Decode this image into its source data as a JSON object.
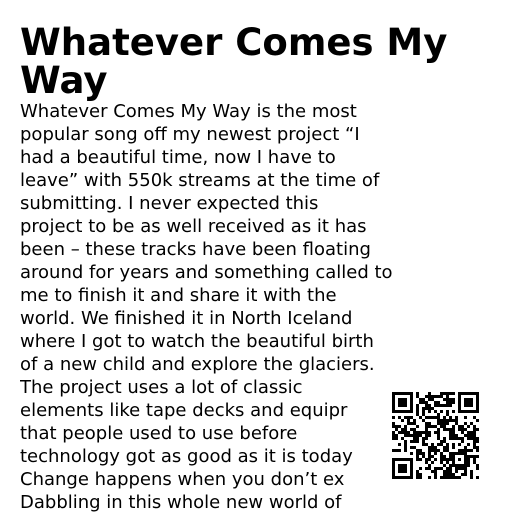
{
  "title": "Whatever Comes My Way",
  "body_lines": [
    "Whatever Comes My Way is the most",
    "popular song off my newest project “I",
    "had a beautiful time, now I have to",
    "leave” with 550k streams at the time of",
    "submitting. I never expected this",
    "project to be as well received as it has",
    "been – these tracks have been floating",
    "around for years and something called to",
    "me to finish it and share it with the",
    "world. We finished it in North Iceland",
    "where I got to watch the beautiful birth",
    "of a new child and explore the glaciers.",
    "The project uses a lot of classic",
    "elements like tape decks and equipr",
    "that people used to use before",
    "technology got as good as it is today",
    "Change happens when you don’t ex",
    "Dabbling in this whole new world of"
  ],
  "qr_code": {
    "icon": "qr-code-icon",
    "color": "#000000"
  }
}
